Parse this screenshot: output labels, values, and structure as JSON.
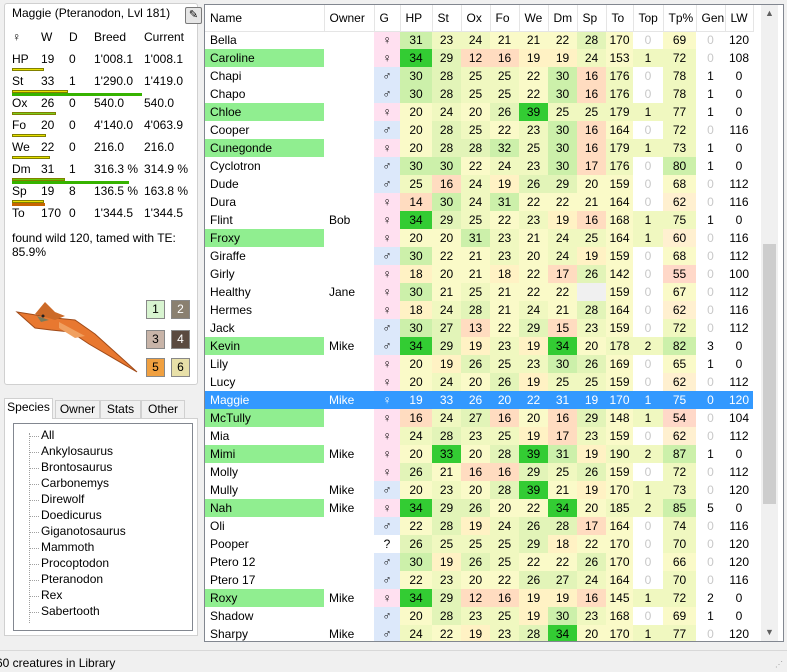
{
  "creature": {
    "title": "Maggie (Pteranodon, Lvl 181)",
    "col_w": "W",
    "col_d": "D",
    "col_breed": "Breed",
    "col_current": "Current",
    "stats": [
      {
        "sym": "♀",
        "w": "",
        "d": "",
        "breed": "",
        "current": "",
        "is_sex": true
      },
      {
        "label": "HP",
        "w": "19",
        "d": "0",
        "breed": "1'008.1",
        "current": "1'008.1",
        "bar_color": "#e8e000",
        "bar_fraction": 0.4
      },
      {
        "label": "St",
        "w": "33",
        "d": "1",
        "breed": "1'290.0",
        "current": "1'419.0",
        "bar_color": "#e8e000",
        "bar2_color": "#36b300",
        "bar_fraction": 0.7,
        "bar2_fraction": 0.74
      },
      {
        "label": "Ox",
        "w": "26",
        "d": "0",
        "breed": "540.0",
        "current": "540.0",
        "bar_color": "#7acd1e",
        "bar_fraction": 0.55
      },
      {
        "label": "Fo",
        "w": "20",
        "d": "0",
        "breed": "4'140.0",
        "current": "4'063.9",
        "bar_color": "#e8e000",
        "bar_fraction": 0.42
      },
      {
        "label": "We",
        "w": "22",
        "d": "0",
        "breed": "216.0",
        "current": "216.0",
        "bar_color": "#e8e000",
        "bar_fraction": 0.47
      },
      {
        "label": "Dm",
        "w": "31",
        "d": "1",
        "breed": "316.3 %",
        "current": "314.9 %",
        "bar_color": "#66c800",
        "bar2_color": "#36b300",
        "bar_fraction": 0.66,
        "bar2_fraction": 0.67
      },
      {
        "label": "Sp",
        "w": "19",
        "d": "8",
        "breed": "136.5 %",
        "current": "163.8 %",
        "bar_color": "#e8e000",
        "bar2_color": "#c86400",
        "bar_fraction": 0.4,
        "bar2_fraction": 0.19
      },
      {
        "label": "To",
        "w": "170",
        "d": "0",
        "breed": "1'344.5",
        "current": "1'344.5"
      }
    ],
    "te_note": "found wild 120, tamed with TE: 85.9%",
    "color_buttons": [
      {
        "label": "1",
        "bg": "#d8f4d0"
      },
      {
        "label": "2",
        "bg": "#8a8070"
      },
      {
        "label": "3",
        "bg": "#c8b4a8"
      },
      {
        "label": "4",
        "bg": "#5a4a40"
      },
      {
        "label": "5",
        "bg": "#f0a040"
      },
      {
        "label": "6",
        "bg": "#e8e0a8"
      }
    ],
    "portrait_icon": "pteranodon-icon"
  },
  "tabs": [
    "Species",
    "Owner",
    "Stats",
    "Other"
  ],
  "species_tree": [
    "All",
    "Ankylosaurus",
    "Brontosaurus",
    "Carbonemys",
    "Direwolf",
    "Doedicurus",
    "Giganotosaurus",
    "Mammoth",
    "Procoptodon",
    "Pteranodon",
    "Rex",
    "Sabertooth"
  ],
  "columns": [
    "Name",
    "Owner",
    "G",
    "HP",
    "St",
    "Ox",
    "Fo",
    "We",
    "Dm",
    "Sp",
    "To",
    "Top",
    "Tp%",
    "Gen",
    "LW"
  ],
  "rows": [
    [
      "Bella",
      "",
      "♀",
      "31",
      "23",
      "24",
      "21",
      "21",
      "22",
      "28",
      "170",
      "0",
      "69",
      "0",
      "120"
    ],
    [
      "Caroline",
      "",
      "♀",
      "34",
      "29",
      "12",
      "16",
      "19",
      "19",
      "24",
      "153",
      "1",
      "72",
      "0",
      "108"
    ],
    [
      "Chapi",
      "",
      "♂",
      "30",
      "28",
      "25",
      "25",
      "22",
      "30",
      "16",
      "176",
      "0",
      "78",
      "1",
      "0"
    ],
    [
      "Chapo",
      "",
      "♂",
      "30",
      "28",
      "25",
      "25",
      "22",
      "30",
      "16",
      "176",
      "0",
      "78",
      "1",
      "0"
    ],
    [
      "Chloe",
      "",
      "♀",
      "20",
      "24",
      "20",
      "26",
      "39",
      "25",
      "25",
      "179",
      "1",
      "77",
      "1",
      "0"
    ],
    [
      "Cooper",
      "",
      "♂",
      "20",
      "28",
      "25",
      "22",
      "23",
      "30",
      "16",
      "164",
      "0",
      "72",
      "0",
      "116"
    ],
    [
      "Cunegonde",
      "",
      "♀",
      "20",
      "28",
      "28",
      "32",
      "25",
      "30",
      "16",
      "179",
      "1",
      "73",
      "1",
      "0"
    ],
    [
      "Cyclotron",
      "",
      "♂",
      "30",
      "30",
      "22",
      "24",
      "23",
      "30",
      "17",
      "176",
      "0",
      "80",
      "1",
      "0"
    ],
    [
      "Dude",
      "",
      "♂",
      "25",
      "16",
      "24",
      "19",
      "26",
      "29",
      "20",
      "159",
      "0",
      "68",
      "0",
      "112"
    ],
    [
      "Dura",
      "",
      "♀",
      "14",
      "30",
      "24",
      "31",
      "22",
      "22",
      "21",
      "164",
      "0",
      "62",
      "0",
      "116"
    ],
    [
      "Flint",
      "Bob",
      "♀",
      "34",
      "29",
      "25",
      "22",
      "23",
      "19",
      "16",
      "168",
      "1",
      "75",
      "1",
      "0"
    ],
    [
      "Froxy",
      "",
      "♀",
      "20",
      "20",
      "31",
      "23",
      "21",
      "24",
      "25",
      "164",
      "1",
      "60",
      "0",
      "116"
    ],
    [
      "Giraffe",
      "",
      "♂",
      "30",
      "22",
      "21",
      "23",
      "20",
      "24",
      "19",
      "159",
      "0",
      "68",
      "0",
      "112"
    ],
    [
      "Girly",
      "",
      "♀",
      "18",
      "20",
      "21",
      "18",
      "22",
      "17",
      "26",
      "142",
      "0",
      "55",
      "0",
      "100"
    ],
    [
      "Healthy",
      "Jane",
      "♀",
      "30",
      "21",
      "25",
      "21",
      "22",
      "22",
      "",
      "159",
      "0",
      "67",
      "0",
      "112"
    ],
    [
      "Hermes",
      "",
      "♀",
      "18",
      "24",
      "28",
      "21",
      "24",
      "21",
      "28",
      "164",
      "0",
      "62",
      "0",
      "116"
    ],
    [
      "Jack",
      "",
      "♂",
      "30",
      "27",
      "13",
      "22",
      "29",
      "15",
      "23",
      "159",
      "0",
      "72",
      "0",
      "112"
    ],
    [
      "Kevin",
      "Mike",
      "♂",
      "34",
      "29",
      "19",
      "23",
      "19",
      "34",
      "20",
      "178",
      "2",
      "82",
      "3",
      "0"
    ],
    [
      "Lily",
      "",
      "♀",
      "20",
      "19",
      "26",
      "25",
      "23",
      "30",
      "26",
      "169",
      "0",
      "65",
      "1",
      "0"
    ],
    [
      "Lucy",
      "",
      "♀",
      "20",
      "24",
      "20",
      "26",
      "19",
      "25",
      "25",
      "159",
      "0",
      "62",
      "0",
      "112"
    ],
    [
      "Maggie",
      "Mike",
      "♀",
      "19",
      "33",
      "26",
      "20",
      "22",
      "31",
      "19",
      "170",
      "1",
      "75",
      "0",
      "120"
    ],
    [
      "McTully",
      "",
      "♀",
      "16",
      "24",
      "27",
      "16",
      "20",
      "16",
      "29",
      "148",
      "1",
      "54",
      "0",
      "104"
    ],
    [
      "Mia",
      "",
      "♀",
      "24",
      "28",
      "23",
      "25",
      "19",
      "17",
      "23",
      "159",
      "0",
      "62",
      "0",
      "112"
    ],
    [
      "Mimi",
      "Mike",
      "♀",
      "20",
      "33",
      "20",
      "28",
      "39",
      "31",
      "19",
      "190",
      "2",
      "87",
      "1",
      "0"
    ],
    [
      "Molly",
      "",
      "♀",
      "26",
      "21",
      "16",
      "16",
      "29",
      "25",
      "26",
      "159",
      "0",
      "72",
      "0",
      "112"
    ],
    [
      "Mully",
      "Mike",
      "♂",
      "20",
      "23",
      "20",
      "28",
      "39",
      "21",
      "19",
      "170",
      "1",
      "73",
      "0",
      "120"
    ],
    [
      "Nah",
      "Mike",
      "♀",
      "34",
      "29",
      "26",
      "20",
      "22",
      "34",
      "20",
      "185",
      "2",
      "85",
      "5",
      "0"
    ],
    [
      "Oli",
      "",
      "♂",
      "22",
      "28",
      "19",
      "24",
      "26",
      "28",
      "17",
      "164",
      "0",
      "74",
      "0",
      "116"
    ],
    [
      "Pooper",
      "",
      "?",
      "26",
      "25",
      "25",
      "25",
      "29",
      "18",
      "22",
      "170",
      "0",
      "70",
      "0",
      "120"
    ],
    [
      "Ptero 12",
      "",
      "♂",
      "30",
      "19",
      "26",
      "25",
      "22",
      "22",
      "26",
      "170",
      "0",
      "66",
      "0",
      "120"
    ],
    [
      "Ptero 17",
      "",
      "♂",
      "22",
      "23",
      "20",
      "22",
      "26",
      "27",
      "24",
      "164",
      "0",
      "70",
      "0",
      "116"
    ],
    [
      "Roxy",
      "Mike",
      "♀",
      "34",
      "29",
      "12",
      "16",
      "19",
      "19",
      "16",
      "145",
      "1",
      "72",
      "2",
      "0"
    ],
    [
      "Shadow",
      "",
      "♂",
      "20",
      "28",
      "23",
      "25",
      "19",
      "30",
      "23",
      "168",
      "0",
      "69",
      "1",
      "0"
    ],
    [
      "Sharpy",
      "Mike",
      "♂",
      "24",
      "22",
      "19",
      "23",
      "28",
      "34",
      "20",
      "170",
      "1",
      "77",
      "0",
      "120"
    ]
  ],
  "highlighted_names": [
    "Caroline",
    "Chloe",
    "Cunegonde",
    "Froxy",
    "Kevin",
    "McTully",
    "Mimi",
    "Nah",
    "Roxy"
  ],
  "selected_row": "Maggie",
  "status": "60 creatures in Library"
}
